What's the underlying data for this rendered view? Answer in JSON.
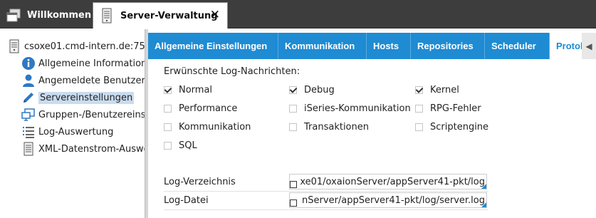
{
  "window_tabs": [
    {
      "label": "Willkommen",
      "icon": "window-icon",
      "active": false
    },
    {
      "label": "Server-Verwaltung",
      "icon": "server-icon",
      "active": true,
      "closable": true
    }
  ],
  "tree": {
    "root": {
      "label": "csoxe01.cmd-intern.de:75",
      "icon": "server-icon"
    },
    "items": [
      {
        "label": "Allgemeine Informationen",
        "icon": "info-icon"
      },
      {
        "label": "Angemeldete Benutzer",
        "icon": "user-icon"
      },
      {
        "label": "Servereinstellungen",
        "icon": "pencil-icon",
        "selected": true
      },
      {
        "label": "Gruppen-/Benutzereinstellungen",
        "icon": "monitor-icon"
      },
      {
        "label": "Log-Auswertung",
        "icon": "log-list-icon"
      },
      {
        "label": "XML-Datenstrom-Auswertung",
        "icon": "document-icon"
      }
    ]
  },
  "content_tabs": [
    {
      "label": "Allgemeine Einstellungen"
    },
    {
      "label": "Kommunikation"
    },
    {
      "label": "Hosts"
    },
    {
      "label": "Repositories"
    },
    {
      "label": "Scheduler"
    },
    {
      "label": "Protokoll",
      "active": true
    }
  ],
  "form": {
    "heading": "Erwünschte Log-Nachrichten:",
    "checkboxes": [
      {
        "label": "Normal",
        "checked": true
      },
      {
        "label": "Debug",
        "checked": true
      },
      {
        "label": "Kernel",
        "checked": true
      },
      {
        "label": "Performance",
        "checked": false
      },
      {
        "label": "iSeries-Kommunikation",
        "checked": false
      },
      {
        "label": "RPG-Fehler",
        "checked": false
      },
      {
        "label": "Kommunikation",
        "checked": false
      },
      {
        "label": "Transaktionen",
        "checked": false
      },
      {
        "label": "Scriptengine",
        "checked": false
      },
      {
        "label": "SQL",
        "checked": false
      }
    ],
    "log_dir": {
      "label": "Log-Verzeichnis",
      "value": "xe01/oxaionServer/appServer41-pkt/log"
    },
    "log_file": {
      "label": "Log-Datei",
      "value": "nServer/appServer41-pkt/log/server.log"
    }
  },
  "colors": {
    "accent": "#1e8bd3",
    "topbar": "#3d3d3d",
    "selection": "#c9dcef"
  }
}
